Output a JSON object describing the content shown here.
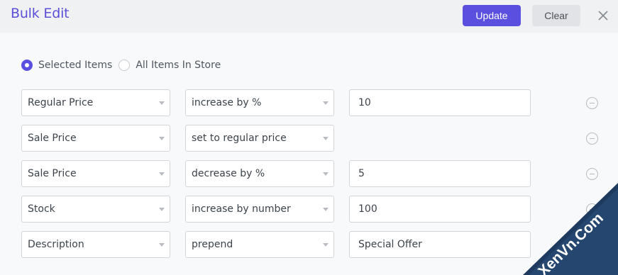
{
  "header": {
    "title": "Bulk Edit",
    "update_label": "Update",
    "clear_label": "Clear",
    "close_icon": "close-icon"
  },
  "scope": {
    "options": [
      {
        "label": "Selected Items",
        "checked": true
      },
      {
        "label": "All Items In Store",
        "checked": false
      }
    ]
  },
  "rows": [
    {
      "field": "Regular Price",
      "operation": "increase by %",
      "value": "10"
    },
    {
      "field": "Sale Price",
      "operation": "set to regular price",
      "value": null
    },
    {
      "field": "Sale Price",
      "operation": "decrease by %",
      "value": "5"
    },
    {
      "field": "Stock",
      "operation": "increase by number",
      "value": "100"
    },
    {
      "field": "Description",
      "operation": "prepend",
      "value": "Special Offer"
    }
  ],
  "watermark": {
    "text": "XenVn.Com"
  },
  "colors": {
    "accent": "#5b4fe0",
    "watermark_bg": "#1e3a5f"
  }
}
